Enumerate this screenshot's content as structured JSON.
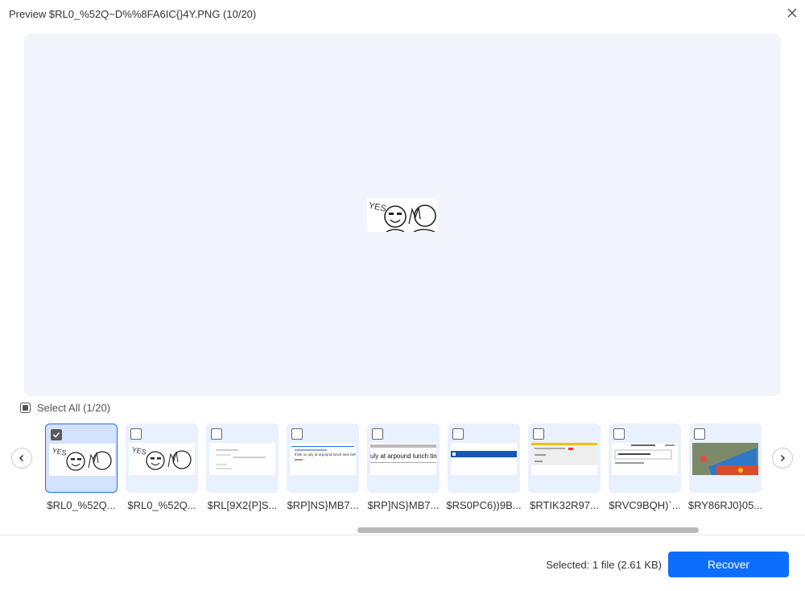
{
  "window": {
    "title": "Preview $RL0_%52Q~D%%8FA6IC{}4Y.PNG (10/20)",
    "close_icon": "close-icon"
  },
  "preview": {
    "image_text": "YES"
  },
  "select_all": {
    "label": "Select All (1/20)",
    "state": "partial"
  },
  "thumbnails": [
    {
      "name": "$RL0_%52Q...",
      "checked": true,
      "selected": true,
      "kind": "meme",
      "text": "YES"
    },
    {
      "name": "$RL0_%52Q...",
      "checked": false,
      "selected": false,
      "kind": "meme",
      "text": "YES"
    },
    {
      "name": "$RL[9X2{P]S...",
      "checked": false,
      "selected": false,
      "kind": "doc",
      "text": ""
    },
    {
      "name": "$RP]NS}MB7...",
      "checked": false,
      "selected": false,
      "kind": "chat",
      "text": "think so july at arpound lunch time before 1pm"
    },
    {
      "name": "$RP]NS}MB7...",
      "checked": false,
      "selected": false,
      "kind": "chatbig",
      "text": "uly at arpound lunch tim"
    },
    {
      "name": "$RS0PC6))9B...",
      "checked": false,
      "selected": false,
      "kind": "bluebar",
      "text": ""
    },
    {
      "name": "$RTIK32R97...",
      "checked": false,
      "selected": false,
      "kind": "form",
      "text": ""
    },
    {
      "name": "$RVC9BQH)`...",
      "checked": false,
      "selected": false,
      "kind": "list",
      "text": ""
    },
    {
      "name": "$RY86RJ0}05...",
      "checked": false,
      "selected": false,
      "kind": "photo",
      "text": ""
    }
  ],
  "footer": {
    "selected_text": "Selected: 1 file (2.61 KB)",
    "recover_label": "Recover"
  },
  "colors": {
    "accent": "#0d6efd",
    "preview_bg": "#f2f5fc",
    "thumb_bg": "#e9f0fe",
    "thumb_selected_bg": "#d3e2fe"
  }
}
